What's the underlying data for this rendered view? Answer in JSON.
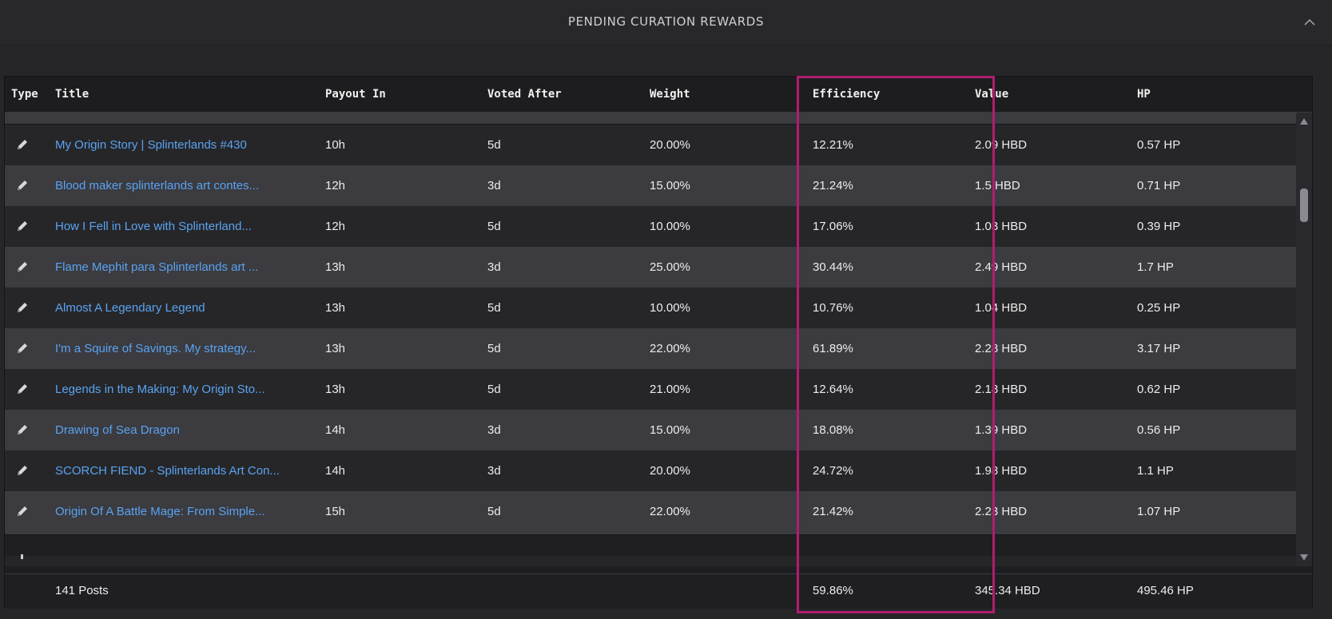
{
  "panel": {
    "title": "PENDING CURATION REWARDS",
    "collapse_icon": "chevron-up-icon"
  },
  "table": {
    "headers": {
      "type": "Type",
      "title": "Title",
      "payout_in": "Payout In",
      "voted_after": "Voted After",
      "weight": "Weight",
      "efficiency": "Efficiency",
      "value": "Value",
      "hp": "HP"
    },
    "rows": [
      {
        "type_icon": "pencil-icon",
        "title": "My Origin Story | Splinterlands #430",
        "payout_in": "10h",
        "voted_after": "5d",
        "weight": "20.00%",
        "efficiency": "12.21%",
        "value": "2.09 HBD",
        "hp": "0.57 HP"
      },
      {
        "type_icon": "pencil-icon",
        "title": "Blood maker splinterlands art contes...",
        "payout_in": "12h",
        "voted_after": "3d",
        "weight": "15.00%",
        "efficiency": "21.24%",
        "value": "1.5 HBD",
        "hp": "0.71 HP"
      },
      {
        "type_icon": "pencil-icon",
        "title": "How I Fell in Love with Splinterland...",
        "payout_in": "12h",
        "voted_after": "5d",
        "weight": "10.00%",
        "efficiency": "17.06%",
        "value": "1.03 HBD",
        "hp": "0.39 HP"
      },
      {
        "type_icon": "pencil-icon",
        "title": "Flame Mephit para Splinterlands art ...",
        "payout_in": "13h",
        "voted_after": "3d",
        "weight": "25.00%",
        "efficiency": "30.44%",
        "value": "2.49 HBD",
        "hp": "1.7 HP"
      },
      {
        "type_icon": "pencil-icon",
        "title": "Almost A Legendary Legend",
        "payout_in": "13h",
        "voted_after": "5d",
        "weight": "10.00%",
        "efficiency": "10.76%",
        "value": "1.04 HBD",
        "hp": "0.25 HP"
      },
      {
        "type_icon": "pencil-icon",
        "title": "I'm a Squire of Savings. My strategy...",
        "payout_in": "13h",
        "voted_after": "5d",
        "weight": "22.00%",
        "efficiency": "61.89%",
        "value": "2.28 HBD",
        "hp": "3.17 HP"
      },
      {
        "type_icon": "pencil-icon",
        "title": "Legends in the Making: My Origin Sto...",
        "payout_in": "13h",
        "voted_after": "5d",
        "weight": "21.00%",
        "efficiency": "12.64%",
        "value": "2.18 HBD",
        "hp": "0.62 HP"
      },
      {
        "type_icon": "pencil-icon",
        "title": "Drawing of Sea Dragon",
        "payout_in": "14h",
        "voted_after": "3d",
        "weight": "15.00%",
        "efficiency": "18.08%",
        "value": "1.39 HBD",
        "hp": "0.56 HP"
      },
      {
        "type_icon": "pencil-icon",
        "title": "SCORCH FIEND - Splinterlands Art Con...",
        "payout_in": "14h",
        "voted_after": "3d",
        "weight": "20.00%",
        "efficiency": "24.72%",
        "value": "1.98 HBD",
        "hp": "1.1 HP"
      },
      {
        "type_icon": "pencil-icon",
        "title": "Origin Of A Battle Mage: From Simple...",
        "payout_in": "15h",
        "voted_after": "5d",
        "weight": "22.00%",
        "efficiency": "21.42%",
        "value": "2.23 HBD",
        "hp": "1.07 HP"
      }
    ],
    "footer": {
      "posts": "141 Posts",
      "efficiency": "59.86%",
      "value": "345.34 HBD",
      "hp": "495.46 HP"
    }
  },
  "colors": {
    "link": "#5aa3f0",
    "highlight_box": "#b01d6e",
    "row_even": "#3b3b40",
    "row_odd": "#262629"
  }
}
